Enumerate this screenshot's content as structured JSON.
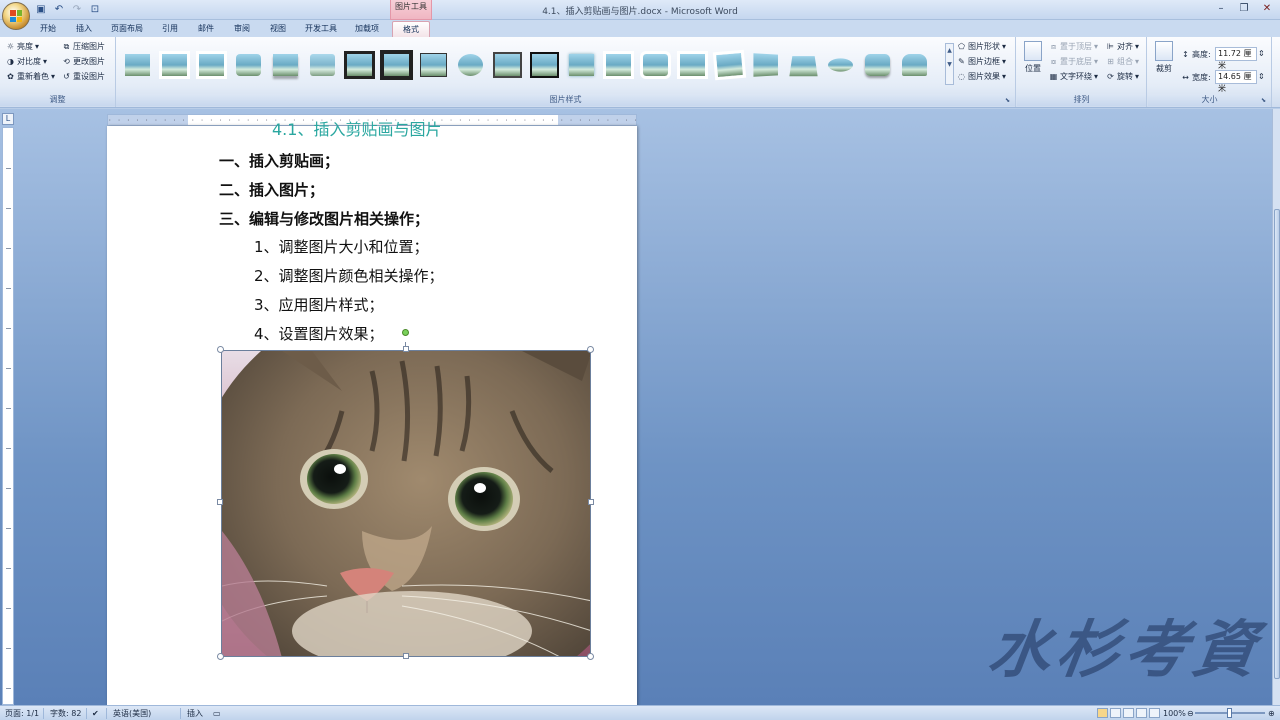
{
  "window": {
    "title": "4.1、插入剪贴画与图片.docx - Microsoft Word",
    "context_tab_group": "图片工具"
  },
  "quick_access": [
    "save-icon",
    "undo-icon",
    "redo-icon",
    "open-icon"
  ],
  "tabs": [
    {
      "label": "开始",
      "active": false
    },
    {
      "label": "插入",
      "active": false
    },
    {
      "label": "页面布局",
      "active": false
    },
    {
      "label": "引用",
      "active": false
    },
    {
      "label": "邮件",
      "active": false
    },
    {
      "label": "审阅",
      "active": false
    },
    {
      "label": "视图",
      "active": false
    },
    {
      "label": "开发工具",
      "active": false
    },
    {
      "label": "加载项",
      "active": false
    },
    {
      "label": "格式",
      "active": true
    }
  ],
  "ribbon": {
    "adjust": {
      "label": "调整",
      "brightness": "亮度",
      "contrast": "对比度",
      "recolor": "重新着色",
      "compress": "压缩图片",
      "change": "更改图片",
      "reset": "重设图片"
    },
    "styles": {
      "label": "图片样式",
      "shape": "图片形状",
      "border": "图片边框",
      "effects": "图片效果"
    },
    "arrange": {
      "label": "排列",
      "position": "位置",
      "bring_front": "置于顶层",
      "send_back": "置于底层",
      "text_wrap": "文字环绕",
      "align": "对齐",
      "group": "组合",
      "rotate": "旋转"
    },
    "size": {
      "label": "大小",
      "crop": "裁剪",
      "height_label": "高度:",
      "height_value": "11.72 厘米",
      "width_label": "宽度:",
      "width_value": "14.65 厘米"
    }
  },
  "document": {
    "heading_fragment": "4.1、插入剪贴画与图片",
    "lines": [
      {
        "text": "一、插入剪贴画；",
        "bold": true
      },
      {
        "text": "二、插入图片；",
        "bold": true
      },
      {
        "text": "三、编辑与修改图片相关操作；",
        "bold": true
      },
      {
        "text": "1、调整图片大小和位置；",
        "bold": false
      },
      {
        "text": "2、调整图片颜色相关操作；",
        "bold": false
      },
      {
        "text": "3、应用图片样式；",
        "bold": false
      },
      {
        "text": "4、设置图片效果；",
        "bold": false
      }
    ]
  },
  "statusbar": {
    "page": "页面: 1/1",
    "words": "字数: 82",
    "language": "英语(美国)",
    "mode": "插入",
    "zoom": "100%"
  },
  "watermark": "水杉考资",
  "colors": {
    "context_tab": "#f0b6c2",
    "heading": "#2aa7a0",
    "workspace": "#6e93c4"
  }
}
